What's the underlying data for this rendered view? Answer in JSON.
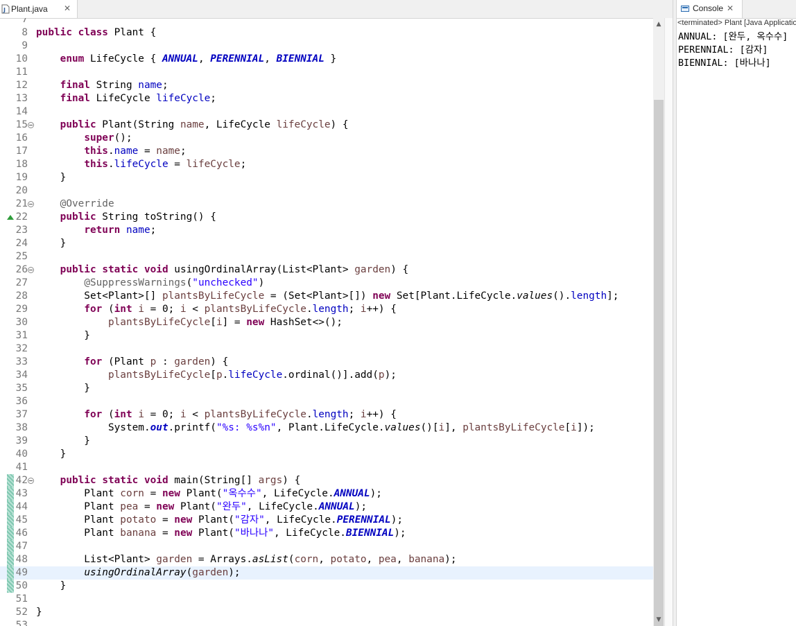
{
  "editor": {
    "tab_label": "Plant.java",
    "close_glyph": "✕",
    "lines": [
      {
        "n": "7",
        "html": ""
      },
      {
        "n": "8",
        "html": "<span class=\"kw\">public</span> <span class=\"kw\">class</span> Plant {"
      },
      {
        "n": "9",
        "html": ""
      },
      {
        "n": "10",
        "html": "    <span class=\"kw\">enum</span> LifeCycle { <span class=\"enumc\">ANNUAL</span>, <span class=\"enumc\">PERENNIAL</span>, <span class=\"enumc\">BIENNIAL</span> }"
      },
      {
        "n": "11",
        "html": ""
      },
      {
        "n": "12",
        "html": "    <span class=\"kw\">final</span> String <span class=\"fld\">name</span>;"
      },
      {
        "n": "13",
        "html": "    <span class=\"kw\">final</span> LifeCycle <span class=\"fld\">lifeCycle</span>;"
      },
      {
        "n": "14",
        "html": ""
      },
      {
        "n": "15",
        "fold": true,
        "html": "    <span class=\"kw\">public</span> Plant(String <span class=\"param\">name</span>, LifeCycle <span class=\"param\">lifeCycle</span>) {"
      },
      {
        "n": "16",
        "html": "        <span class=\"kw\">super</span>();"
      },
      {
        "n": "17",
        "html": "        <span class=\"kw\">this</span>.<span class=\"fld\">name</span> = <span class=\"param\">name</span>;"
      },
      {
        "n": "18",
        "html": "        <span class=\"kw\">this</span>.<span class=\"fld\">lifeCycle</span> = <span class=\"param\">lifeCycle</span>;"
      },
      {
        "n": "19",
        "html": "    }"
      },
      {
        "n": "20",
        "html": ""
      },
      {
        "n": "21",
        "fold": true,
        "html": "    <span class=\"ann\">@Override</span>"
      },
      {
        "n": "22",
        "override": true,
        "html": "    <span class=\"kw\">public</span> String toString() {"
      },
      {
        "n": "23",
        "html": "        <span class=\"kw\">return</span> <span class=\"fld\">name</span>;"
      },
      {
        "n": "24",
        "html": "    }"
      },
      {
        "n": "25",
        "html": ""
      },
      {
        "n": "26",
        "fold": true,
        "html": "    <span class=\"kw\">public</span> <span class=\"kw\">static</span> <span class=\"kw\">void</span> usingOrdinalArray(List&lt;Plant&gt; <span class=\"param\">garden</span>) {"
      },
      {
        "n": "27",
        "html": "        <span class=\"ann\">@SuppressWarnings</span>(<span class=\"str\">\"unchecked\"</span>)"
      },
      {
        "n": "28",
        "html": "        Set&lt;Plant&gt;[] <span class=\"param\">plantsByLifeCycle</span> = (Set&lt;Plant&gt;[]) <span class=\"kw\">new</span> Set[Plant.LifeCycle.<span class=\"it\">values</span>().<span class=\"fld\">length</span>];"
      },
      {
        "n": "29",
        "html": "        <span class=\"kw\">for</span> (<span class=\"kw\">int</span> <span class=\"param\">i</span> = 0; <span class=\"param\">i</span> &lt; <span class=\"param\">plantsByLifeCycle</span>.<span class=\"fld\">length</span>; <span class=\"param\">i</span>++) {"
      },
      {
        "n": "30",
        "html": "            <span class=\"param\">plantsByLifeCycle</span>[<span class=\"param\">i</span>] = <span class=\"kw\">new</span> HashSet&lt;&gt;();"
      },
      {
        "n": "31",
        "html": "        }"
      },
      {
        "n": "32",
        "html": ""
      },
      {
        "n": "33",
        "html": "        <span class=\"kw\">for</span> (Plant <span class=\"param\">p</span> : <span class=\"param\">garden</span>) {"
      },
      {
        "n": "34",
        "html": "            <span class=\"param\">plantsByLifeCycle</span>[<span class=\"param\">p</span>.<span class=\"fld\">lifeCycle</span>.ordinal()].add(<span class=\"param\">p</span>);"
      },
      {
        "n": "35",
        "html": "        }"
      },
      {
        "n": "36",
        "html": ""
      },
      {
        "n": "37",
        "html": "        <span class=\"kw\">for</span> (<span class=\"kw\">int</span> <span class=\"param\">i</span> = 0; <span class=\"param\">i</span> &lt; <span class=\"param\">plantsByLifeCycle</span>.<span class=\"fld\">length</span>; <span class=\"param\">i</span>++) {"
      },
      {
        "n": "38",
        "html": "            System.<span class=\"sfld\">out</span>.printf(<span class=\"str\">\"%s: %s%n\"</span>, Plant.LifeCycle.<span class=\"it\">values</span>()[<span class=\"param\">i</span>], <span class=\"param\">plantsByLifeCycle</span>[<span class=\"param\">i</span>]);"
      },
      {
        "n": "39",
        "html": "        }"
      },
      {
        "n": "40",
        "html": "    }"
      },
      {
        "n": "41",
        "html": ""
      },
      {
        "n": "42",
        "fold": true,
        "changed": true,
        "html": "    <span class=\"kw\">public</span> <span class=\"kw\">static</span> <span class=\"kw\">void</span> main(String[] <span class=\"param\">args</span>) {"
      },
      {
        "n": "43",
        "changed": true,
        "html": "        Plant <span class=\"param\">corn</span> = <span class=\"kw\">new</span> Plant(<span class=\"str\">\"옥수수\"</span>, LifeCycle.<span class=\"enumc\">ANNUAL</span>);"
      },
      {
        "n": "44",
        "changed": true,
        "html": "        Plant <span class=\"param\">pea</span> = <span class=\"kw\">new</span> Plant(<span class=\"str\">\"완두\"</span>, LifeCycle.<span class=\"enumc\">ANNUAL</span>);"
      },
      {
        "n": "45",
        "changed": true,
        "html": "        Plant <span class=\"param\">potato</span> = <span class=\"kw\">new</span> Plant(<span class=\"str\">\"감자\"</span>, LifeCycle.<span class=\"enumc\">PERENNIAL</span>);"
      },
      {
        "n": "46",
        "changed": true,
        "html": "        Plant <span class=\"param\">banana</span> = <span class=\"kw\">new</span> Plant(<span class=\"str\">\"바나나\"</span>, LifeCycle.<span class=\"enumc\">BIENNIAL</span>);"
      },
      {
        "n": "47",
        "changed": true,
        "html": ""
      },
      {
        "n": "48",
        "changed": true,
        "html": "        List&lt;Plant&gt; <span class=\"param\">garden</span> = Arrays.<span class=\"it\">asList</span>(<span class=\"param\">corn</span>, <span class=\"param\">potato</span>, <span class=\"param\">pea</span>, <span class=\"param\">banana</span>);"
      },
      {
        "n": "49",
        "changed": true,
        "current": true,
        "html": "        <span class=\"it\">usingOrdinalArray</span>(<span class=\"param\">garden</span>);"
      },
      {
        "n": "50",
        "changed": true,
        "html": "    }"
      },
      {
        "n": "51",
        "html": ""
      },
      {
        "n": "52",
        "html": "}"
      },
      {
        "n": "53",
        "html": ""
      }
    ]
  },
  "console": {
    "tab_label": "Console",
    "close_glyph": "✕",
    "status": "<terminated> Plant [Java Application]",
    "output": [
      "ANNUAL: [완두, 옥수수]",
      "PERENNIAL: [감자]",
      "BIENNIAL: [바나나]"
    ]
  },
  "colors": {
    "keyword": "#7f0055",
    "field": "#0000c0",
    "string": "#2a00ff",
    "annotation": "#646464",
    "current_line": "#e8f2fe"
  }
}
